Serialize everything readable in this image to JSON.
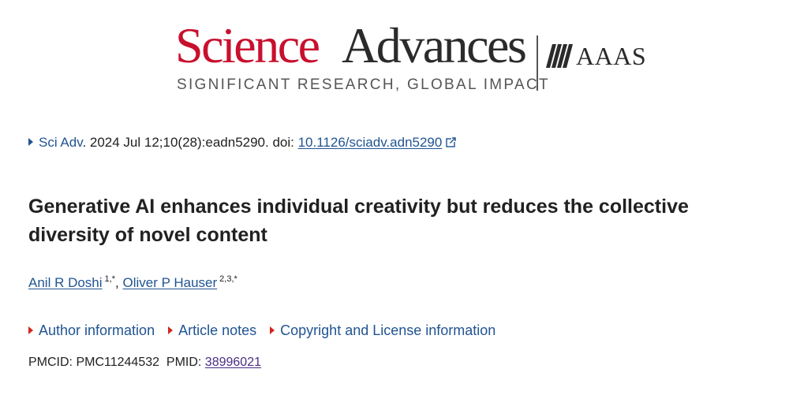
{
  "masthead": {
    "brand_first": "Science",
    "brand_second": "Advances",
    "tagline": "SIGNIFICANT RESEARCH, GLOBAL IMPACT",
    "publisher": "AAAS",
    "brand_color": "#c8102e"
  },
  "citation": {
    "journal": "Sci Adv",
    "details": ". 2024 Jul 12;10(28):eadn5290. doi: ",
    "doi": "10.1126/sciadv.adn5290",
    "doi_icon": "external-link-icon"
  },
  "article": {
    "title": "Generative AI enhances individual creativity but reduces the collective diversity of novel content"
  },
  "authors": [
    {
      "name": "Anil R Doshi",
      "affiliations": "1,*"
    },
    {
      "name": "Oliver P Hauser",
      "affiliations": "2,3,*"
    }
  ],
  "author_separator": ", ",
  "info_links": [
    {
      "label": "Author information"
    },
    {
      "label": "Article notes"
    },
    {
      "label": "Copyright and License information"
    }
  ],
  "ids": {
    "pmcid_label": "PMCID: ",
    "pmcid": "PMC11244532",
    "pmid_label": "PMID: ",
    "pmid": "38996021"
  },
  "colors": {
    "link": "#205493",
    "visited_link": "#4b2c83",
    "accent_triangle": "#d3261e"
  }
}
